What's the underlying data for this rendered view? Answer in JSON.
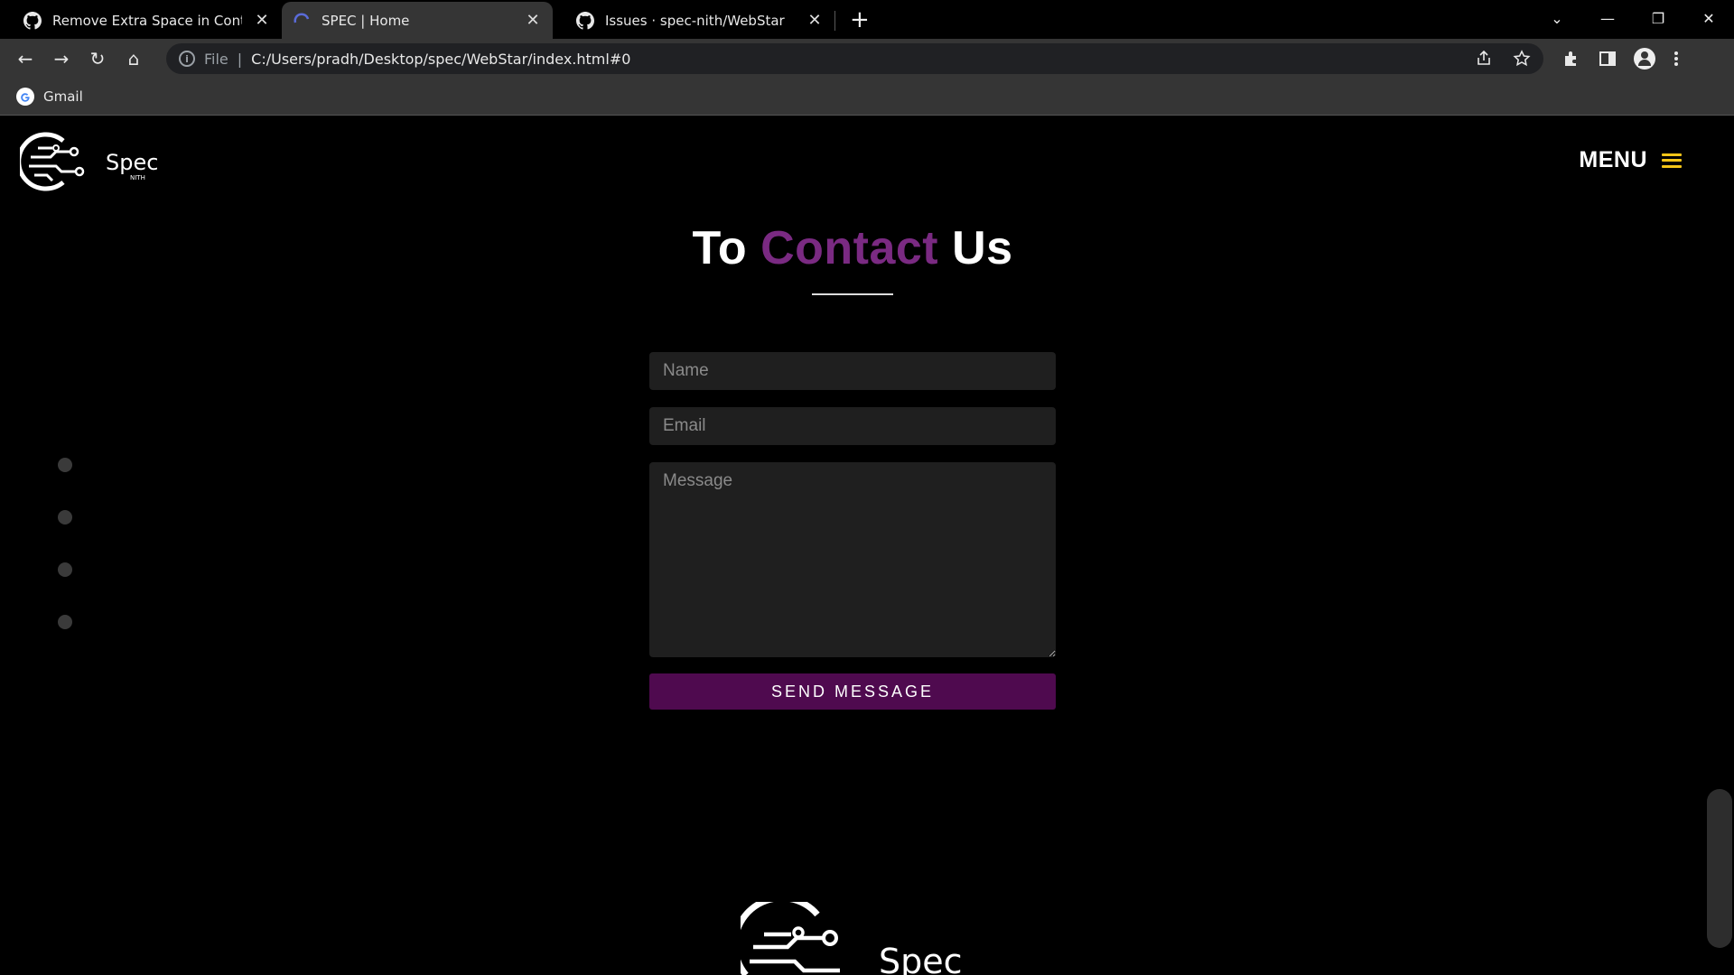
{
  "browser": {
    "tabs": [
      {
        "title": "Remove Extra Space in Contact U",
        "close": "✕",
        "favicon": "github-icon",
        "active": false
      },
      {
        "title": "SPEC | Home",
        "close": "✕",
        "favicon": "spec-favicon",
        "active": true
      },
      {
        "title": "Issues · spec-nith/WebStar",
        "close": "✕",
        "favicon": "github-icon",
        "active": false
      }
    ],
    "new_tab": "+",
    "window_controls": {
      "tab_search": "⌄",
      "minimize": "—",
      "restore": "❐",
      "close": "✕"
    },
    "nav": {
      "back": "←",
      "forward": "→",
      "reload": "↻",
      "home": "⌂"
    },
    "omnibox": {
      "scheme_label": "File",
      "separator": "|",
      "url": "C:/Users/pradh/Desktop/spec/WebStar/index.html#0"
    },
    "bookmarks": [
      {
        "label": "Gmail",
        "icon": "google-icon"
      }
    ]
  },
  "page": {
    "logo_text": "Spec",
    "logo_subtext": "NITH",
    "menu_label": "MENU",
    "heading": {
      "before": "To ",
      "accent": "Contact",
      "after": " Us"
    },
    "form": {
      "name_placeholder": "Name",
      "email_placeholder": "Email",
      "message_placeholder": "Message",
      "submit_label": "SEND MESSAGE"
    },
    "side_dots_count": 4,
    "footer_logo_text": "Spec"
  },
  "colors": {
    "accent": "#7a2a82",
    "button": "#4f0a4f",
    "menu_icon": "#f5c518",
    "field_bg": "#1f1f1f"
  }
}
